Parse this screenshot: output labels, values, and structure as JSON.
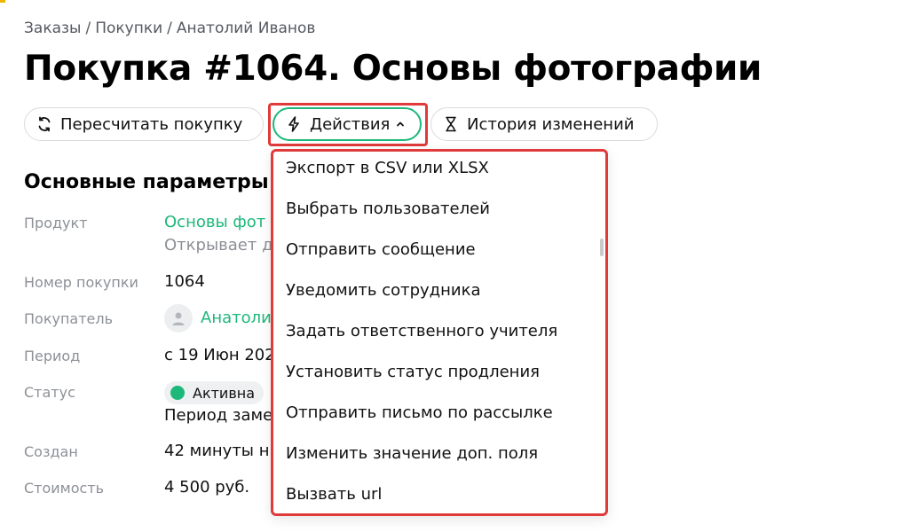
{
  "breadcrumb": {
    "items": [
      "Заказы",
      "Покупки",
      "Анатолий Иванов"
    ],
    "separator": "/"
  },
  "page_title": "Покупка #1064. Основы фотографии",
  "toolbar": {
    "recalc_label": "Пересчитать покупку",
    "actions_label": "Действия",
    "history_label": "История изменений"
  },
  "section_title": "Основные параметры",
  "params": {
    "product_label": "Продукт",
    "product_value": "Основы фот",
    "product_note": "Открывает д",
    "number_label": "Номер покупки",
    "number_value": "1064",
    "buyer_label": "Покупатель",
    "buyer_value": "Анатоли",
    "period_label": "Период",
    "period_value": "с 19 Июн 202",
    "status_label": "Статус",
    "status_badge": "Активна",
    "status_note": "Период заме",
    "created_label": "Создан",
    "created_value": "42 минуты н",
    "cost_label": "Стоимость",
    "cost_value": "4 500 руб."
  },
  "actions_menu": {
    "items": [
      "Экспорт в CSV или XLSX",
      "Выбрать пользователей",
      "Отправить сообщение",
      "Уведомить сотрудника",
      "Задать ответственного учителя",
      "Установить статус продления",
      "Отправить письмо по рассылке",
      "Изменить значение доп. поля",
      "Вызвать url"
    ]
  },
  "colors": {
    "accent_green": "#1db87a",
    "highlight_red": "#e03a3a",
    "muted_text": "#8c9096"
  },
  "icons": {
    "recalc": "refresh-icon",
    "actions": "lightning-icon",
    "actions_chevron": "chevron-up-icon",
    "history": "hourglass-icon",
    "avatar": "user-icon"
  }
}
